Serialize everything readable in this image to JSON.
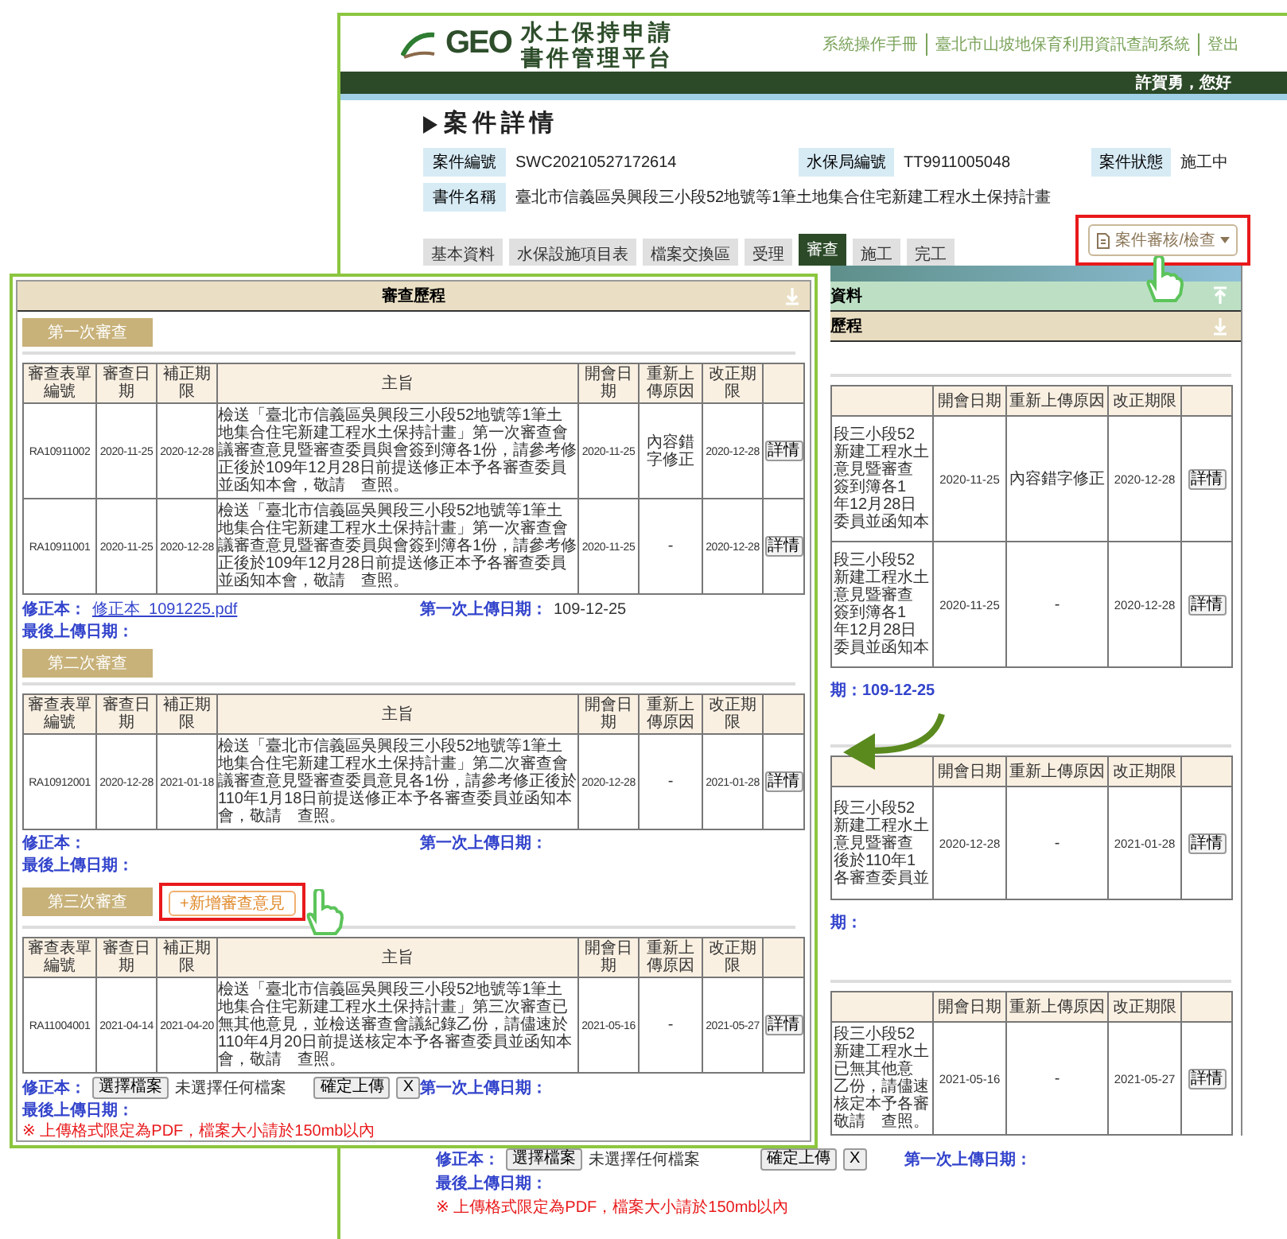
{
  "back_window": {
    "logo": {
      "mark": "GEO",
      "title_lines": [
        "水土保持申請",
        "書件管理平台"
      ]
    },
    "top_links": [
      "系統操作手冊",
      "臺北市山坡地保育利用資訊查詢系統",
      "登出"
    ],
    "greeting": "許賀勇，您好",
    "page_title": "案件詳情",
    "fields": [
      {
        "label": "案件編號",
        "value": "SWC20210527172614"
      },
      {
        "label": "水保局編號",
        "value": "TT9911005048"
      },
      {
        "label": "案件狀態",
        "value": "施工中"
      },
      {
        "label": "書件名稱",
        "value": "臺北市信義區吳興段三小段52地號等1筆土地集合住宅新建工程水土保持計畫"
      }
    ],
    "tabs": [
      {
        "label": "基本資料",
        "selected": false
      },
      {
        "label": "水保設施項目表",
        "selected": false
      },
      {
        "label": "檔案交換區",
        "selected": false
      },
      {
        "label": "受理",
        "selected": false
      },
      {
        "label": "審查",
        "selected": true
      },
      {
        "label": "施工",
        "selected": false
      },
      {
        "label": "完工",
        "selected": false
      }
    ],
    "action_button": {
      "label": "案件審核/檢查",
      "highlighted": true
    },
    "panels": [
      {
        "label": "資料",
        "kind": "collapse"
      },
      {
        "label": "歷程",
        "kind": "expand"
      }
    ],
    "rounds": [
      {
        "columns": [
          "開會日期",
          "重新上傳原因",
          "改正期限"
        ],
        "rows": [
          {
            "subject_lines": [
              "段三小段52",
              "新建工程水土",
              "意見暨審查",
              "簽到簿各1",
              "年12月28日",
              "委員並函知本"
            ],
            "meeting_date": "2020-11-25",
            "reason": "內容錯字修正",
            "deadline": "2020-12-28",
            "button": "詳情"
          },
          {
            "subject_lines": [
              "段三小段52",
              "新建工程水土",
              "意見暨審查",
              "簽到簿各1",
              "年12月28日",
              "委員並函知本"
            ],
            "meeting_date": "2020-11-25",
            "reason": "-",
            "deadline": "2020-12-28",
            "button": "詳情"
          }
        ],
        "upload_fragment": "期：109-12-25"
      },
      {
        "columns": [
          "開會日期",
          "重新上傳原因",
          "改正期限"
        ],
        "rows": [
          {
            "subject_lines": [
              "段三小段52",
              "新建工程水土",
              "意見暨審查",
              "後於110年1",
              "各審查委員並"
            ],
            "meeting_date": "2020-12-28",
            "reason": "-",
            "deadline": "2021-01-28",
            "button": "詳情"
          }
        ],
        "upload_fragment": "期："
      },
      {
        "columns": [
          "開會日期",
          "重新上傳原因",
          "改正期限"
        ],
        "rows": [
          {
            "subject_lines": [
              "段三小段52",
              "新建工程水土",
              "已無其他意",
              "乙份，請儘速",
              "核定本予各審",
              "敬請　查照。"
            ],
            "meeting_date": "2021-05-16",
            "reason": "-",
            "deadline": "2021-05-27",
            "button": "詳情"
          }
        ]
      }
    ],
    "footer": {
      "revision_label": "修正本：",
      "choose": "選擇檔案",
      "no_file": "未選擇任何檔案",
      "confirm": "確定上傳",
      "clear": "X",
      "first_upload": "第一次上傳日期：",
      "last_upload": "最後上傳日期：",
      "note": "※ 上傳格式限定為PDF，檔案大小請於150mb以內"
    }
  },
  "front_window": {
    "title": "審查歷程",
    "rounds": [
      {
        "label": "第一次審查",
        "columns": [
          "審查表單編號",
          "審查日期",
          "補正期限",
          "主旨",
          "開會日期",
          "重新上傳原因",
          "改正期限"
        ],
        "rows": [
          {
            "id": "RA10911002",
            "review_date": "2020-11-25",
            "fix_deadline": "2020-12-28",
            "subject": "檢送「臺北市信義區吳興段三小段52地號等1筆土地集合住宅新建工程水土保持計畫」第一次審查會議審查意見暨審查委員與會簽到簿各1份，請參考修正後於109年12月28日前提送修正本予各審查委員並函知本會，敬請　查照。",
            "meeting_date": "2020-11-25",
            "reason": "內容錯字修正",
            "deadline": "2020-12-28",
            "button": "詳情"
          },
          {
            "id": "RA10911001",
            "review_date": "2020-11-25",
            "fix_deadline": "2020-12-28",
            "subject": "檢送「臺北市信義區吳興段三小段52地號等1筆土地集合住宅新建工程水土保持計畫」第一次審查會議審查意見暨審查委員與會簽到簿各1份，請參考修正後於109年12月28日前提送修正本予各審查委員並函知本會，敬請　查照。",
            "meeting_date": "2020-11-25",
            "reason": "-",
            "deadline": "2020-12-28",
            "button": "詳情"
          }
        ],
        "revision_label": "修正本：",
        "revision_file": "修正本_1091225.pdf",
        "first_upload_label": "第一次上傳日期：",
        "first_upload": "109-12-25",
        "last_upload_label": "最後上傳日期："
      },
      {
        "label": "第二次審查",
        "columns": [
          "審查表單編號",
          "審查日期",
          "補正期限",
          "主旨",
          "開會日期",
          "重新上傳原因",
          "改正期限"
        ],
        "rows": [
          {
            "id": "RA10912001",
            "review_date": "2020-12-28",
            "fix_deadline": "2021-01-18",
            "subject": "檢送「臺北市信義區吳興段三小段52地號等1筆土地集合住宅新建工程水土保持計畫」第二次審查會議審查意見暨審查委員意見各1份，請參考修正後於110年1月18日前提送修正本予各審查委員並函知本會，敬請　查照。",
            "meeting_date": "2020-12-28",
            "reason": "-",
            "deadline": "2021-01-28",
            "button": "詳情"
          }
        ],
        "revision_label": "修正本：",
        "first_upload_label": "第一次上傳日期：",
        "last_upload_label": "最後上傳日期："
      },
      {
        "label": "第三次審查",
        "add_button": {
          "label": "+新增審查意見",
          "highlighted": true
        },
        "columns": [
          "審查表單編號",
          "審查日期",
          "補正期限",
          "主旨",
          "開會日期",
          "重新上傳原因",
          "改正期限"
        ],
        "rows": [
          {
            "id": "RA11004001",
            "review_date": "2021-04-14",
            "fix_deadline": "2021-04-20",
            "subject": "檢送「臺北市信義區吳興段三小段52地號等1筆土地集合住宅新建工程水土保持計畫」第三次審查已無其他意見，並檢送審查會議紀錄乙份，請儘速於110年4月20日前提送核定本予各審查委員並函知本會，敬請　查照。",
            "meeting_date": "2021-05-16",
            "reason": "-",
            "deadline": "2021-05-27",
            "button": "詳情"
          }
        ],
        "revision_label": "修正本：",
        "upload": {
          "choose": "選擇檔案",
          "no_file": "未選擇任何檔案",
          "confirm": "確定上傳",
          "clear": "X"
        },
        "first_upload_label": "第一次上傳日期：",
        "last_upload_label": "最後上傳日期：",
        "note": "※ 上傳格式限定為PDF，檔案大小請於150mb以內"
      }
    ]
  }
}
